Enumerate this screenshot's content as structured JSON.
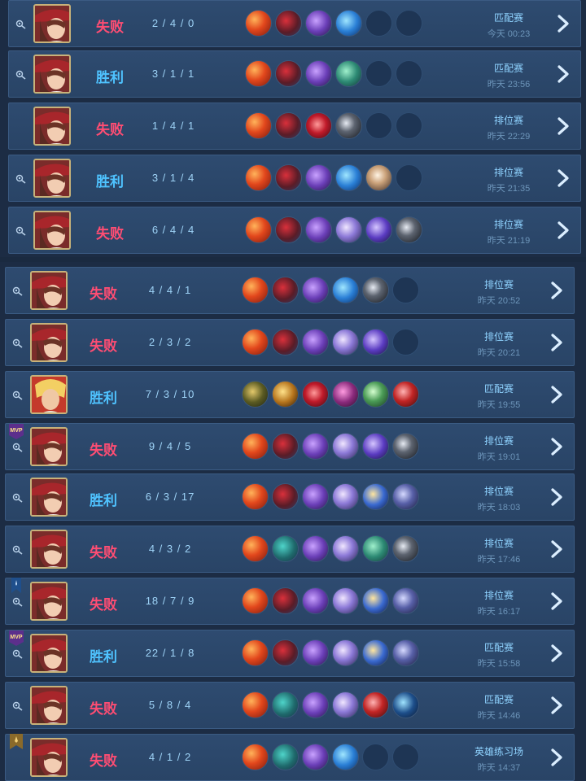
{
  "colors": {
    "lose": "#ff4d73",
    "win": "#4fc3ff"
  },
  "matches": [
    {
      "result": "失败",
      "outcome": "lose",
      "kda": "2 / 4 / 0",
      "mode": "匹配赛",
      "time": "今天 00:23",
      "hero": "red-hat-hero",
      "items": [
        "red",
        "boots",
        "purple",
        "blue",
        "empty",
        "empty"
      ],
      "watch": true
    },
    {
      "result": "胜利",
      "outcome": "win",
      "kda": "3 / 1 / 1",
      "mode": "匹配赛",
      "time": "昨天 23:56",
      "hero": "red-hat-hero",
      "items": [
        "red",
        "boots",
        "purple",
        "teal",
        "empty",
        "empty"
      ],
      "watch": true
    },
    {
      "result": "失败",
      "outcome": "lose",
      "kda": "1 / 4 / 1",
      "mode": "排位赛",
      "time": "昨天 22:29",
      "hero": "red-hat-hero",
      "items": [
        "red",
        "boots",
        "crimson",
        "dark",
        "empty",
        "empty"
      ],
      "watch": false
    },
    {
      "result": "胜利",
      "outcome": "win",
      "kda": "3 / 1 / 4",
      "mode": "排位赛",
      "time": "昨天 21:35",
      "hero": "red-hat-hero",
      "items": [
        "red",
        "boots",
        "purple",
        "blue",
        "mask",
        "empty"
      ],
      "watch": true
    },
    {
      "result": "失败",
      "outcome": "lose",
      "kda": "6 / 4 / 4",
      "mode": "排位赛",
      "time": "昨天 21:19",
      "hero": "red-hat-hero",
      "items": [
        "red",
        "boots",
        "purple",
        "lavender",
        "violet",
        "dark"
      ],
      "watch": true
    },
    {
      "result": "失败",
      "outcome": "lose",
      "kda": "4 / 4 / 1",
      "mode": "排位赛",
      "time": "昨天 20:52",
      "hero": "red-hat-hero",
      "items": [
        "red",
        "boots",
        "purple",
        "blue",
        "dark",
        "empty"
      ],
      "watch": true
    },
    {
      "result": "失败",
      "outcome": "lose",
      "kda": "2 / 3 / 2",
      "mode": "排位赛",
      "time": "昨天 20:21",
      "hero": "red-hat-hero",
      "items": [
        "red",
        "boots",
        "purple",
        "lavender",
        "violet",
        "empty"
      ],
      "watch": true
    },
    {
      "result": "胜利",
      "outcome": "win",
      "kda": "7 / 3 / 10",
      "mode": "匹配赛",
      "time": "昨天 19:55",
      "hero": "blond-hero",
      "items": [
        "olive",
        "gold",
        "crimson",
        "magenta",
        "green",
        "scarlet"
      ],
      "watch": true
    },
    {
      "result": "失败",
      "outcome": "lose",
      "kda": "9 / 4 / 5",
      "mode": "排位赛",
      "time": "昨天 19:01",
      "hero": "red-hat-hero",
      "items": [
        "red",
        "boots",
        "purple",
        "lavender",
        "violet",
        "dark"
      ],
      "watch": true,
      "badge": "MVP"
    },
    {
      "result": "胜利",
      "outcome": "win",
      "kda": "6 / 3 / 17",
      "mode": "排位赛",
      "time": "昨天 18:03",
      "hero": "red-hat-hero",
      "items": [
        "red",
        "boots",
        "purple",
        "lavender",
        "gold-blue",
        "armor"
      ],
      "watch": true
    },
    {
      "result": "失败",
      "outcome": "lose",
      "kda": "4 / 3 / 2",
      "mode": "排位赛",
      "time": "昨天 17:46",
      "hero": "red-hat-hero",
      "items": [
        "red",
        "teal-boots",
        "purple",
        "lavender",
        "teal",
        "dark"
      ],
      "watch": true
    },
    {
      "result": "失败",
      "outcome": "lose",
      "kda": "18 / 7 / 9",
      "mode": "排位赛",
      "time": "昨天 16:17",
      "hero": "red-hat-hero",
      "items": [
        "red",
        "boots",
        "purple",
        "lavender",
        "gold-blue",
        "armor"
      ],
      "watch": true,
      "badge": "bookmark"
    },
    {
      "result": "胜利",
      "outcome": "win",
      "kda": "22 / 1 / 8",
      "mode": "匹配赛",
      "time": "昨天 15:58",
      "hero": "red-hat-hero",
      "items": [
        "red",
        "boots",
        "purple",
        "lavender",
        "gold-blue",
        "armor"
      ],
      "watch": true,
      "badge": "MVP"
    },
    {
      "result": "失败",
      "outcome": "lose",
      "kda": "5 / 8 / 4",
      "mode": "匹配赛",
      "time": "昨天 14:46",
      "hero": "red-hat-hero",
      "items": [
        "red",
        "teal-boots",
        "purple",
        "lavender",
        "scarlet",
        "navy"
      ],
      "watch": true
    },
    {
      "result": "失败",
      "outcome": "lose",
      "kda": "4 / 1 / 2",
      "mode": "英雄练习场",
      "time": "昨天 14:37",
      "hero": "red-hat-hero",
      "items": [
        "red",
        "teal-boots",
        "purple",
        "blue",
        "empty",
        "empty"
      ],
      "watch": false,
      "badge": "gold-bookmark"
    }
  ]
}
